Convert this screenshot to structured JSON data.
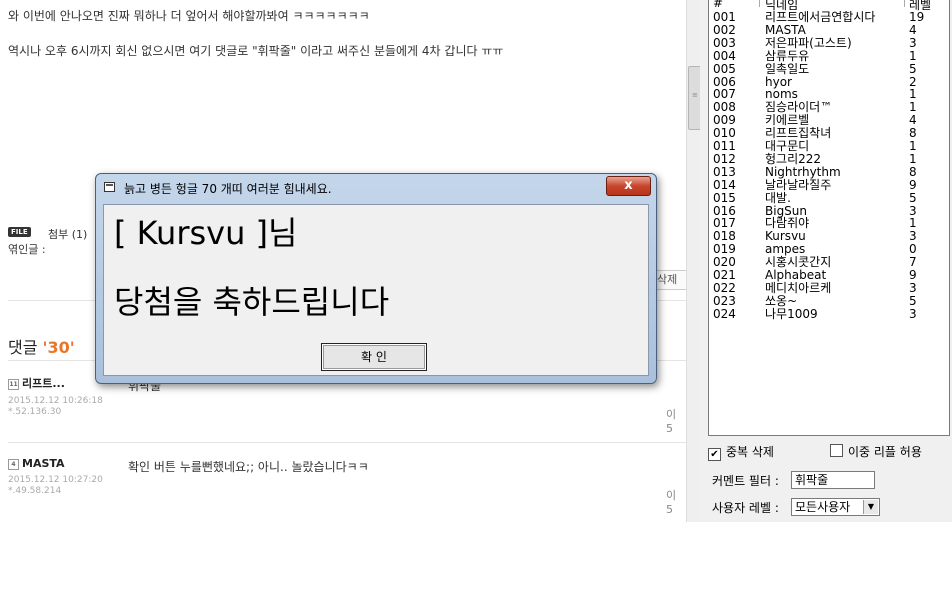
{
  "post": {
    "line1": "와 이번에 안나오면 진짜 뭐하나 더 엎어서 해야할까봐여 ㅋㅋㅋㅋㅋㅋㅋ",
    "line2": "역시나 오후 6시까지 회신 없으시면 여기 댓글로 \"휘팍줄\" 이라고 써주신 분들에게 4차 갑니다 ㅠㅠ",
    "file_badge": "FILE",
    "attach_label": "첨부 (1)",
    "quote_label": "엮인글 :",
    "delete_label": "삭제"
  },
  "comments": {
    "heading": "댓글",
    "count": "'30'",
    "items": [
      {
        "level": "11",
        "author": "리프트...",
        "date": "2015.12.12 10:26:18",
        "ip": "*.52.136.30",
        "text": "휘팍줄",
        "right": "이 5"
      },
      {
        "level": "4",
        "author": "MASTA",
        "date": "2015.12.12 10:27:20",
        "ip": "*.49.58.214",
        "text": "확인 버튼 누를뻔했네요;; 아니.. 놀랐습니다ㅋㅋ",
        "right": "이 5"
      }
    ]
  },
  "panel": {
    "headers": {
      "num": "#",
      "nick": "닉네임",
      "level": "레벨"
    },
    "rows": [
      {
        "num": "001",
        "nick": "리프트에서금연합시다",
        "level": "19"
      },
      {
        "num": "002",
        "nick": "MASTA",
        "level": "4"
      },
      {
        "num": "003",
        "nick": "저은파파(고스트)",
        "level": "3"
      },
      {
        "num": "004",
        "nick": "삼류두유",
        "level": "1"
      },
      {
        "num": "005",
        "nick": "일촉일도",
        "level": "5"
      },
      {
        "num": "006",
        "nick": "hyor",
        "level": "2"
      },
      {
        "num": "007",
        "nick": "noms",
        "level": "1"
      },
      {
        "num": "008",
        "nick": "짐승라이더™",
        "level": "1"
      },
      {
        "num": "009",
        "nick": "키에르벨",
        "level": "4"
      },
      {
        "num": "010",
        "nick": "리프트집착녀",
        "level": "8"
      },
      {
        "num": "011",
        "nick": "대구문디",
        "level": "1"
      },
      {
        "num": "012",
        "nick": "헝그리222",
        "level": "1"
      },
      {
        "num": "013",
        "nick": "Nightrhythm",
        "level": "8"
      },
      {
        "num": "014",
        "nick": "날라날라질주",
        "level": "9"
      },
      {
        "num": "015",
        "nick": "대발.",
        "level": "5"
      },
      {
        "num": "016",
        "nick": "BigSun",
        "level": "3"
      },
      {
        "num": "017",
        "nick": "다람쥐야",
        "level": "1"
      },
      {
        "num": "018",
        "nick": "Kursvu",
        "level": "3"
      },
      {
        "num": "019",
        "nick": "ampes",
        "level": "0"
      },
      {
        "num": "020",
        "nick": "시홍시콧간지",
        "level": "7"
      },
      {
        "num": "021",
        "nick": "Alphabeat",
        "level": "9"
      },
      {
        "num": "022",
        "nick": "메디치아르케",
        "level": "3"
      },
      {
        "num": "023",
        "nick": "쏘옹~",
        "level": "5"
      },
      {
        "num": "024",
        "nick": "나무1009",
        "level": "3"
      }
    ],
    "dedupe": {
      "label": "중복 삭제",
      "checked": true
    },
    "double_reply": {
      "label": "이중 리플 허용",
      "checked": false
    },
    "filter_label": "커멘트 필터 :",
    "filter_value": "휘팍줄",
    "user_level_label": "사용자 레벨 :",
    "user_level_value": "모든사용자"
  },
  "dialog": {
    "title": "늙고 병든 헝글 70 개띠 여러분 힘내세요.",
    "line1": "[ Kursvu ]님",
    "line2": "당첨을 축하드립니다",
    "ok_label": "확 인",
    "close_label": "x"
  }
}
